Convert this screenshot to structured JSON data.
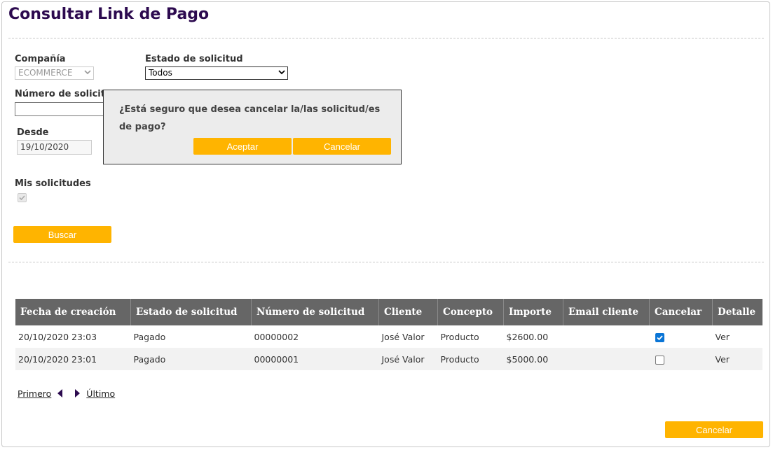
{
  "page": {
    "title": "Consultar Link de Pago"
  },
  "filters": {
    "company_label": "Compañía",
    "company_value": "ECOMMERCE",
    "status_label": "Estado de solicitud",
    "status_value": "Todos",
    "request_number_label": "Número de solicitud",
    "request_number_value": "",
    "from_label": "Desde",
    "from_value": "19/10/2020",
    "my_requests_label": "Mis solicitudes",
    "my_requests_checked": true,
    "search_button": "Buscar"
  },
  "dialog": {
    "message": "¿Está seguro que desea cancelar la/las solicitud/es de pago?",
    "accept_button": "Aceptar",
    "cancel_button": "Cancelar"
  },
  "table": {
    "headers": [
      "Fecha de creación",
      "Estado de solicitud",
      "Número de solicitud",
      "Cliente",
      "Concepto",
      "Importe",
      "Email cliente",
      "Cancelar",
      "Detalle"
    ],
    "rows": [
      {
        "fecha": "20/10/2020 23:03",
        "estado": "Pagado",
        "numero": "00000002",
        "cliente": "José Valor",
        "concepto": "Producto",
        "importe": "$2600.00",
        "email": "",
        "cancelar": true,
        "detalle": "Ver"
      },
      {
        "fecha": "20/10/2020 23:01",
        "estado": "Pagado",
        "numero": "00000001",
        "cliente": "José Valor",
        "concepto": "Producto",
        "importe": "$5000.00",
        "email": "",
        "cancelar": false,
        "detalle": "Ver"
      }
    ]
  },
  "pager": {
    "first": "Primero",
    "last": "Último"
  },
  "footer": {
    "cancel_button": "Cancelar"
  },
  "colors": {
    "title": "#2c0a4f",
    "button": "#ffb400",
    "table_header": "#666666",
    "checkbox_checked": "#0a75d6"
  },
  "icons": {
    "prev": "triangle-left-icon",
    "next": "triangle-right-icon",
    "dropdown": "chevron-down-icon",
    "check": "checkmark-icon"
  }
}
